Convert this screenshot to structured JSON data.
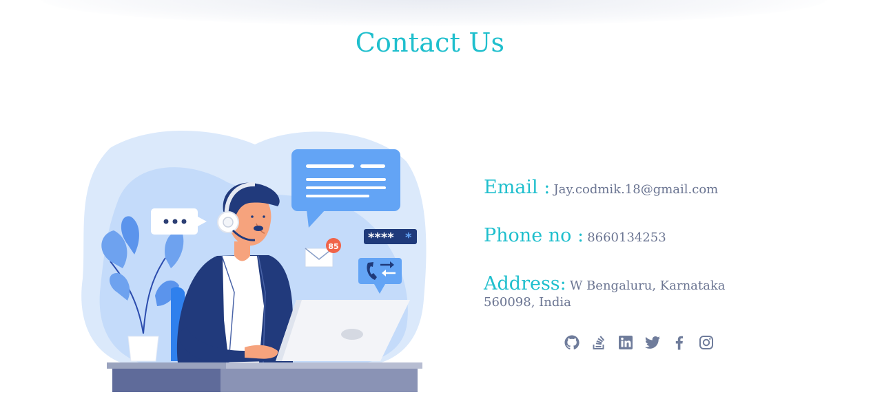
{
  "page": {
    "title": "Contact Us"
  },
  "contact": {
    "email_label": "Email :",
    "email_value": "Jay.codmik.18@gmail.com",
    "phone_label": "Phone no :",
    "phone_value": "8660134253",
    "address_label": "Address:",
    "address_value": "W Bengaluru, Karnataka 560098, India"
  },
  "illustration": {
    "notification_count": "85",
    "password_mask": "****",
    "password_star": "*"
  },
  "socials": [
    {
      "icon": "github-icon"
    },
    {
      "icon": "stackoverflow-icon"
    },
    {
      "icon": "linkedin-icon"
    },
    {
      "icon": "twitter-icon"
    },
    {
      "icon": "facebook-icon"
    },
    {
      "icon": "instagram-icon"
    }
  ],
  "colors": {
    "accent": "#1fbfcd",
    "text_muted": "#6b7592",
    "icon": "#6f7c9b"
  }
}
